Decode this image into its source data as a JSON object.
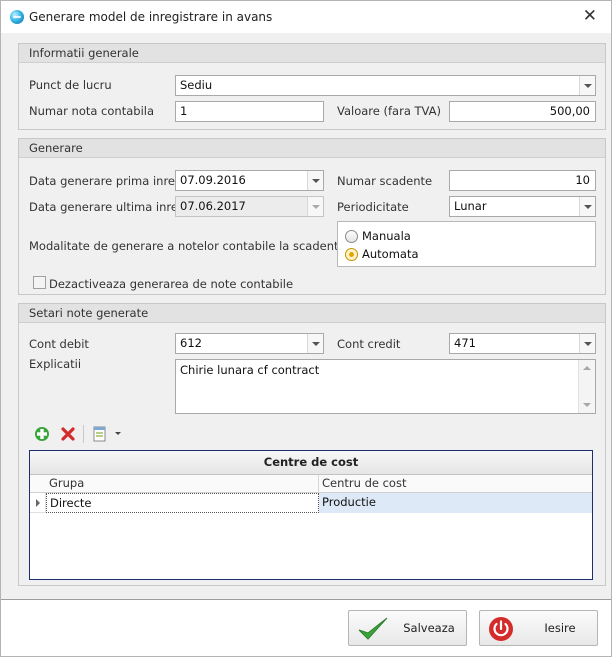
{
  "window": {
    "title": "Generare model de inregistrare in avans",
    "icon": "app-globe-icon"
  },
  "informatii": {
    "header": "Informatii generale",
    "punct_label": "Punct de lucru",
    "punct_value": "Sediu",
    "numar_label": "Numar nota contabila",
    "numar_value": "1",
    "valoare_label": "Valoare (fara TVA)",
    "valoare_value": "500,00"
  },
  "generare": {
    "header": "Generare",
    "prima_label": "Data generare prima inreg.",
    "prima_value": "07.09.2016",
    "ultima_label": "Data generare ultima inreg.",
    "ultima_value": "07.06.2017",
    "scadente_label": "Numar scadente",
    "scadente_value": "10",
    "periodicitate_label": "Periodicitate",
    "periodicitate_value": "Lunar",
    "modalitate_label": "Modalitate de generare a notelor contabile la scadenta",
    "radio_manuala": "Manuala",
    "radio_automata": "Automata",
    "selected_mode": "Automata",
    "dezactiveaza_label": "Dezactiveaza generarea de note contabile",
    "dezactiveaza_checked": false
  },
  "setari": {
    "header": "Setari note generate",
    "cont_debit_label": "Cont debit",
    "cont_debit_value": "612",
    "cont_credit_label": "Cont credit",
    "cont_credit_value": "471",
    "explicatii_label": "Explicatii",
    "explicatii_value": "Chirie lunara cf contract"
  },
  "toolbar": {
    "icons": [
      "add-icon",
      "delete-icon",
      "export-icon"
    ]
  },
  "grid": {
    "caption": "Centre de cost",
    "columns": [
      "Grupa",
      "Centru de cost"
    ],
    "rows": [
      {
        "grupa": "Directe",
        "centru": "Productie"
      }
    ]
  },
  "buttons": {
    "save": "Salveaza",
    "exit": "Iesire"
  },
  "colors": {
    "accent_green": "#3aa53a",
    "exit_red": "#d42b2b",
    "grid_border": "#1c2f70",
    "radio_selected": "#e8a300"
  }
}
